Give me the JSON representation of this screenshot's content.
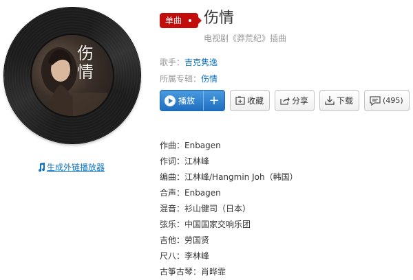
{
  "cover": {
    "title_chars": [
      "伤",
      "情"
    ]
  },
  "song": {
    "badge": "单曲",
    "title": "伤情",
    "subtitle": "电视剧《莽荒纪》插曲"
  },
  "meta": {
    "singer_label": "歌手：",
    "singer": "吉克隽逸",
    "album_label": "所属专辑：",
    "album": "伤情"
  },
  "buttons": {
    "play": "播放",
    "add": "+",
    "collect": "收藏",
    "share": "分享",
    "download": "下载",
    "comment_count": "(495)"
  },
  "ext_player_link": "生成外链播放器",
  "credits": [
    "作曲：Enbagen",
    "作词：江林峰",
    "编曲：江林峰/Hangmin Joh（韩国）",
    "合声：Enbagen",
    "混音：衫山健司（日本）",
    "弦乐：中国国家交响乐团",
    "吉他：劳国贤",
    "尺八：李林峰",
    "古筝古琴：肖晔霏"
  ],
  "colors": {
    "brand_red": "#c10d0c",
    "link_blue": "#0c73c2",
    "play_blue": "#2a7ccd"
  },
  "icons": [
    "note-icon",
    "play-icon",
    "collect-icon",
    "share-icon",
    "download-icon",
    "comment-icon"
  ]
}
